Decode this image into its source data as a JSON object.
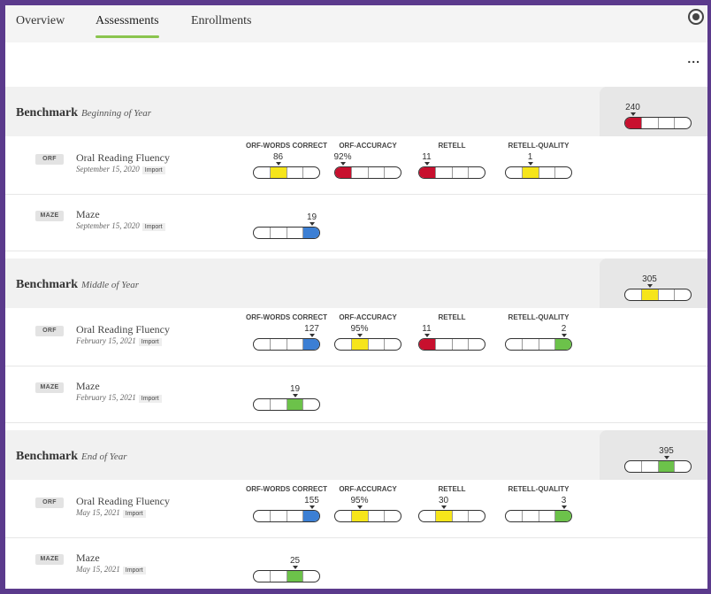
{
  "nav": {
    "tabs": [
      {
        "label": "Overview"
      },
      {
        "label": "Assessments"
      },
      {
        "label": "Enrollments"
      }
    ],
    "more_label": "..."
  },
  "benchmarks": [
    {
      "title": "Benchmark",
      "period": "Beginning of Year",
      "composite": {
        "value": "240",
        "fill_segment": 1,
        "color": "#c8102e"
      },
      "rows": [
        {
          "badge": "ORF",
          "name": "Oral Reading Fluency",
          "date": "September 15, 2020",
          "import": "Import",
          "metrics": [
            {
              "label": "ORF-WORDS CORRECT",
              "value": "86",
              "fill_segment": 2,
              "color": "#f6e51b"
            },
            {
              "label": "ORF-ACCURACY",
              "value": "92%",
              "fill_segment": 1,
              "color": "#c8102e"
            },
            {
              "label": "RETELL",
              "value": "11",
              "fill_segment": 1,
              "color": "#c8102e"
            },
            {
              "label": "RETELL-QUALITY",
              "value": "1",
              "fill_segment": 2,
              "color": "#f6e51b"
            }
          ]
        },
        {
          "badge": "MAZE",
          "name": "Maze",
          "date": "September 15, 2020",
          "import": "Import",
          "metrics": [
            {
              "label": "",
              "value": "19",
              "fill_segment": 4,
              "color": "#3c7fd4"
            }
          ]
        }
      ]
    },
    {
      "title": "Benchmark",
      "period": "Middle of Year",
      "composite": {
        "value": "305",
        "fill_segment": 2,
        "color": "#f6e51b"
      },
      "rows": [
        {
          "badge": "ORF",
          "name": "Oral Reading Fluency",
          "date": "February 15, 2021",
          "import": "Import",
          "metrics": [
            {
              "label": "ORF-WORDS CORRECT",
              "value": "127",
              "fill_segment": 4,
              "color": "#3c7fd4"
            },
            {
              "label": "ORF-ACCURACY",
              "value": "95%",
              "fill_segment": 2,
              "color": "#f6e51b"
            },
            {
              "label": "RETELL",
              "value": "11",
              "fill_segment": 1,
              "color": "#c8102e"
            },
            {
              "label": "RETELL-QUALITY",
              "value": "2",
              "fill_segment": 4,
              "color": "#6cc24a"
            }
          ]
        },
        {
          "badge": "MAZE",
          "name": "Maze",
          "date": "February 15, 2021",
          "import": "Import",
          "metrics": [
            {
              "label": "",
              "value": "19",
              "fill_segment": 3,
              "color": "#6cc24a"
            }
          ]
        }
      ]
    },
    {
      "title": "Benchmark",
      "period": "End of Year",
      "composite": {
        "value": "395",
        "fill_segment": 3,
        "color": "#6cc24a"
      },
      "rows": [
        {
          "badge": "ORF",
          "name": "Oral Reading Fluency",
          "date": "May 15, 2021",
          "import": "Import",
          "metrics": [
            {
              "label": "ORF-WORDS CORRECT",
              "value": "155",
              "fill_segment": 4,
              "color": "#3c7fd4"
            },
            {
              "label": "ORF-ACCURACY",
              "value": "95%",
              "fill_segment": 2,
              "color": "#f6e51b"
            },
            {
              "label": "RETELL",
              "value": "30",
              "fill_segment": 2,
              "color": "#f6e51b"
            },
            {
              "label": "RETELL-QUALITY",
              "value": "3",
              "fill_segment": 4,
              "color": "#6cc24a"
            }
          ]
        },
        {
          "badge": "MAZE",
          "name": "Maze",
          "date": "May 15, 2021",
          "import": "Import",
          "metrics": [
            {
              "label": "",
              "value": "25",
              "fill_segment": 3,
              "color": "#6cc24a"
            }
          ]
        }
      ]
    }
  ]
}
